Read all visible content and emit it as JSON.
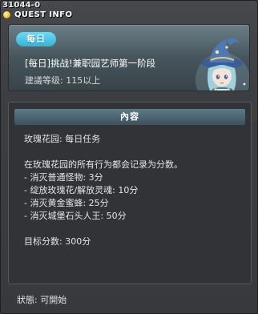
{
  "window": {
    "quest_id": "31044-0",
    "title": "QUEST INFO"
  },
  "header": {
    "badge": "每日",
    "quest_title": "[每日]挑战!兼职园艺师第一阶段",
    "level_text": "建議等级: 115以上",
    "npc_icon": "witch-npc-portrait"
  },
  "content": {
    "header": "內容",
    "lines": [
      "玫瑰花园: 每日任务",
      "",
      "在玫瑰花园的所有行为都会记录为分数。",
      " - 消灭普通怪物: 3分",
      " - 绽放玫瑰花/解放灵魂: 10分",
      " - 消灭黄金蜜蜂: 25分",
      " - 消灭城堡石头人王: 50分",
      "",
      "目标分数: 300分"
    ]
  },
  "status": {
    "label": "狀態:",
    "value": "可開始"
  },
  "colors": {
    "badge": "#33b4da",
    "content_header": "#4a6470",
    "background": "#3a3c40"
  }
}
